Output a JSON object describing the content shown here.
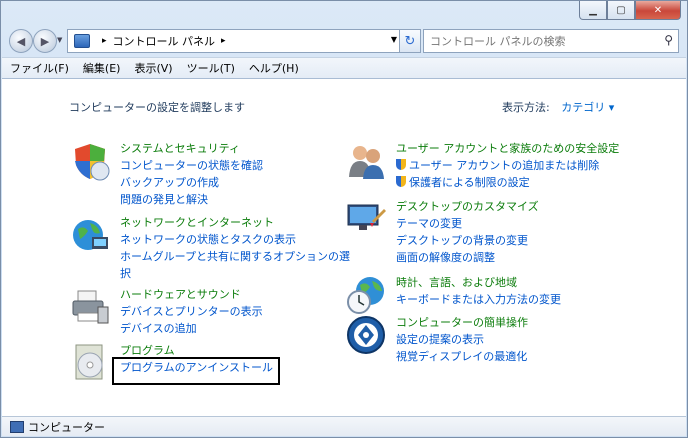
{
  "address": {
    "path": [
      "コントロール パネル"
    ]
  },
  "search": {
    "placeholder": "コントロール パネルの検索"
  },
  "menu": [
    "ファイル(F)",
    "編集(E)",
    "表示(V)",
    "ツール(T)",
    "ヘルプ(H)"
  ],
  "content": {
    "heading": "コンピューターの設定を調整します",
    "view_label": "表示方法:",
    "view_value": "カテゴリ"
  },
  "categories": [
    {
      "title": "システムとセキュリティ",
      "links": [
        "コンピューターの状態を確認",
        "バックアップの作成",
        "問題の発見と解決"
      ]
    },
    {
      "title": "ネットワークとインターネット",
      "links": [
        "ネットワークの状態とタスクの表示",
        "ホームグループと共有に関するオプションの選択"
      ]
    },
    {
      "title": "ハードウェアとサウンド",
      "links": [
        "デバイスとプリンターの表示",
        "デバイスの追加"
      ]
    },
    {
      "title": "プログラム",
      "links": [
        "プログラムのアンインストール"
      ]
    },
    {
      "title": "ユーザー アカウントと家族のための安全設定",
      "links": [
        "ユーザー アカウントの追加または削除",
        "保護者による制限の設定"
      ]
    },
    {
      "title": "デスクトップのカスタマイズ",
      "links": [
        "テーマの変更",
        "デスクトップの背景の変更",
        "画面の解像度の調整"
      ]
    },
    {
      "title": "時計、言語、および地域",
      "links": [
        "キーボードまたは入力方法の変更"
      ]
    },
    {
      "title": "コンピューターの簡単操作",
      "links": [
        "設定の提案の表示",
        "視覚ディスプレイの最適化"
      ]
    }
  ],
  "status": {
    "text": "コンピューター"
  }
}
